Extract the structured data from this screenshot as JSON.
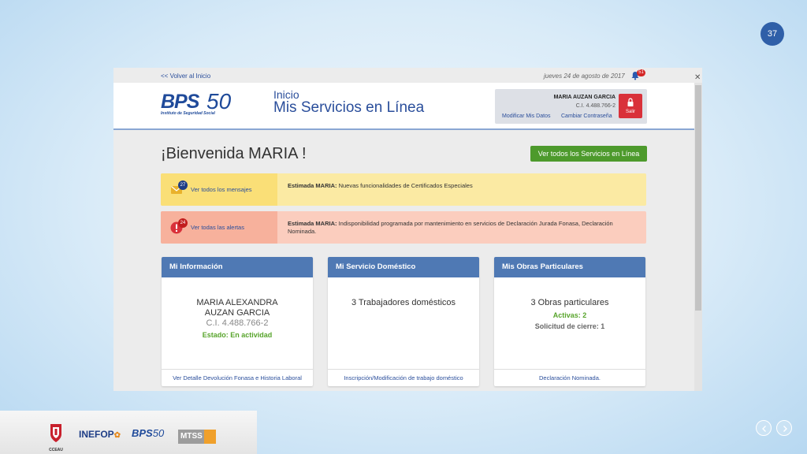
{
  "slide": {
    "number": "37"
  },
  "topbar": {
    "back_link": "<< Volver al Inicio",
    "date": "jueves 24 de agosto de 2017",
    "notifications": "51"
  },
  "header": {
    "logo_text": "BPS",
    "logo_years": "50",
    "logo_sub": "Instituto de Seguridad Social",
    "breadcrumb": "Inicio",
    "title": "Mis Servicios en Línea"
  },
  "user": {
    "name": "MARIA AUZAN GARCIA",
    "ci": "C.I. 4.488.766-2",
    "edit_link": "Modificar Mis Datos",
    "password_link": "Cambiar Contraseña",
    "logout_label": "Salir"
  },
  "main": {
    "welcome": "¡Bienvenida MARIA !",
    "all_services_button": "Ver todos los Servicios en Línea"
  },
  "alerts": [
    {
      "count": "27",
      "link": "Ver todos los mensajes",
      "prefix": "Estimada MARIA:",
      "text": " Nuevas funcionalidades de Certificados Especiales"
    },
    {
      "count": "24",
      "link": "Ver todas las alertas",
      "prefix": "Estimada MARIA:",
      "text": " Indisponibilidad programada por mantenimiento en servicios de Declaración Jurada Fonasa, Declaración Nominada."
    }
  ],
  "cards": [
    {
      "title": "Mi Información",
      "main": "MARIA ALEXANDRA AUZAN GARCIA",
      "sub": "C.I. 4.488.766-2",
      "status": "Estado: En actividad",
      "footer": "Ver Detalle Devolución Fonasa e Historia Laboral"
    },
    {
      "title": "Mi Servicio Doméstico",
      "main": "3 Trabajadores domésticos",
      "footer": "Inscripción/Modificación de trabajo doméstico"
    },
    {
      "title": "Mis Obras Particulares",
      "main": "3 Obras particulares",
      "active": "Activas: 2",
      "closing": "Solicitud de cierre: 1",
      "footer": "Declaración Nominada."
    }
  ],
  "footer_logos": {
    "ccea": "CCEAU",
    "inefop": "INEFOP",
    "bps": "BPS",
    "bps_years": "50",
    "mtss": "MTSS"
  },
  "colors": {
    "brand_blue": "#2a4e9b",
    "card_header": "#4f79b4",
    "success_green": "#4d9a2c",
    "danger_red": "#d9313a"
  }
}
